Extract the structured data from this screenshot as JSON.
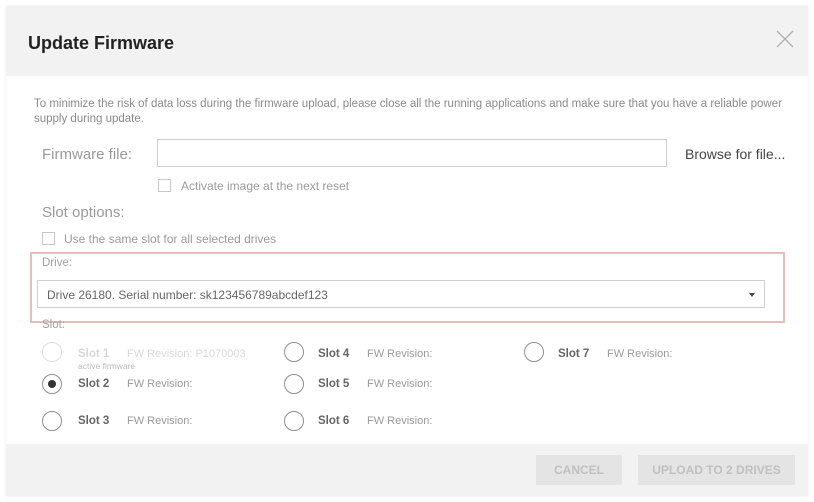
{
  "dialog": {
    "title": "Update Firmware",
    "intro": "To minimize the risk of data loss during the firmware upload, please close all the running applications and make sure that you have a reliable power supply during update."
  },
  "firmware": {
    "label": "Firmware file:",
    "value": "",
    "browse_label": "Browse for file...",
    "activate_label": "Activate image at the next reset"
  },
  "slot_options": {
    "label": "Slot options:",
    "same_slot_label": "Use the same slot for all selected drives"
  },
  "drive": {
    "label": "Drive:",
    "selected": "Drive 26180. Serial number: sk123456789abcdef123"
  },
  "slot_label": "Slot:",
  "slots": [
    {
      "name": "Slot 1",
      "rev_label": "FW Revision: P1070003",
      "note": "active firmware",
      "disabled": true,
      "checked": false
    },
    {
      "name": "Slot 2",
      "rev_label": "FW Revision:",
      "checked": true
    },
    {
      "name": "Slot 3",
      "rev_label": "FW Revision:",
      "checked": false
    },
    {
      "name": "Slot 4",
      "rev_label": "FW Revision:",
      "checked": false
    },
    {
      "name": "Slot 5",
      "rev_label": "FW Revision:",
      "checked": false
    },
    {
      "name": "Slot 6",
      "rev_label": "FW Revision:",
      "checked": false
    },
    {
      "name": "Slot 7",
      "rev_label": "FW Revision:",
      "checked": false
    }
  ],
  "buttons": {
    "cancel": "CANCEL",
    "upload": "UPLOAD TO 2 DRIVES"
  }
}
